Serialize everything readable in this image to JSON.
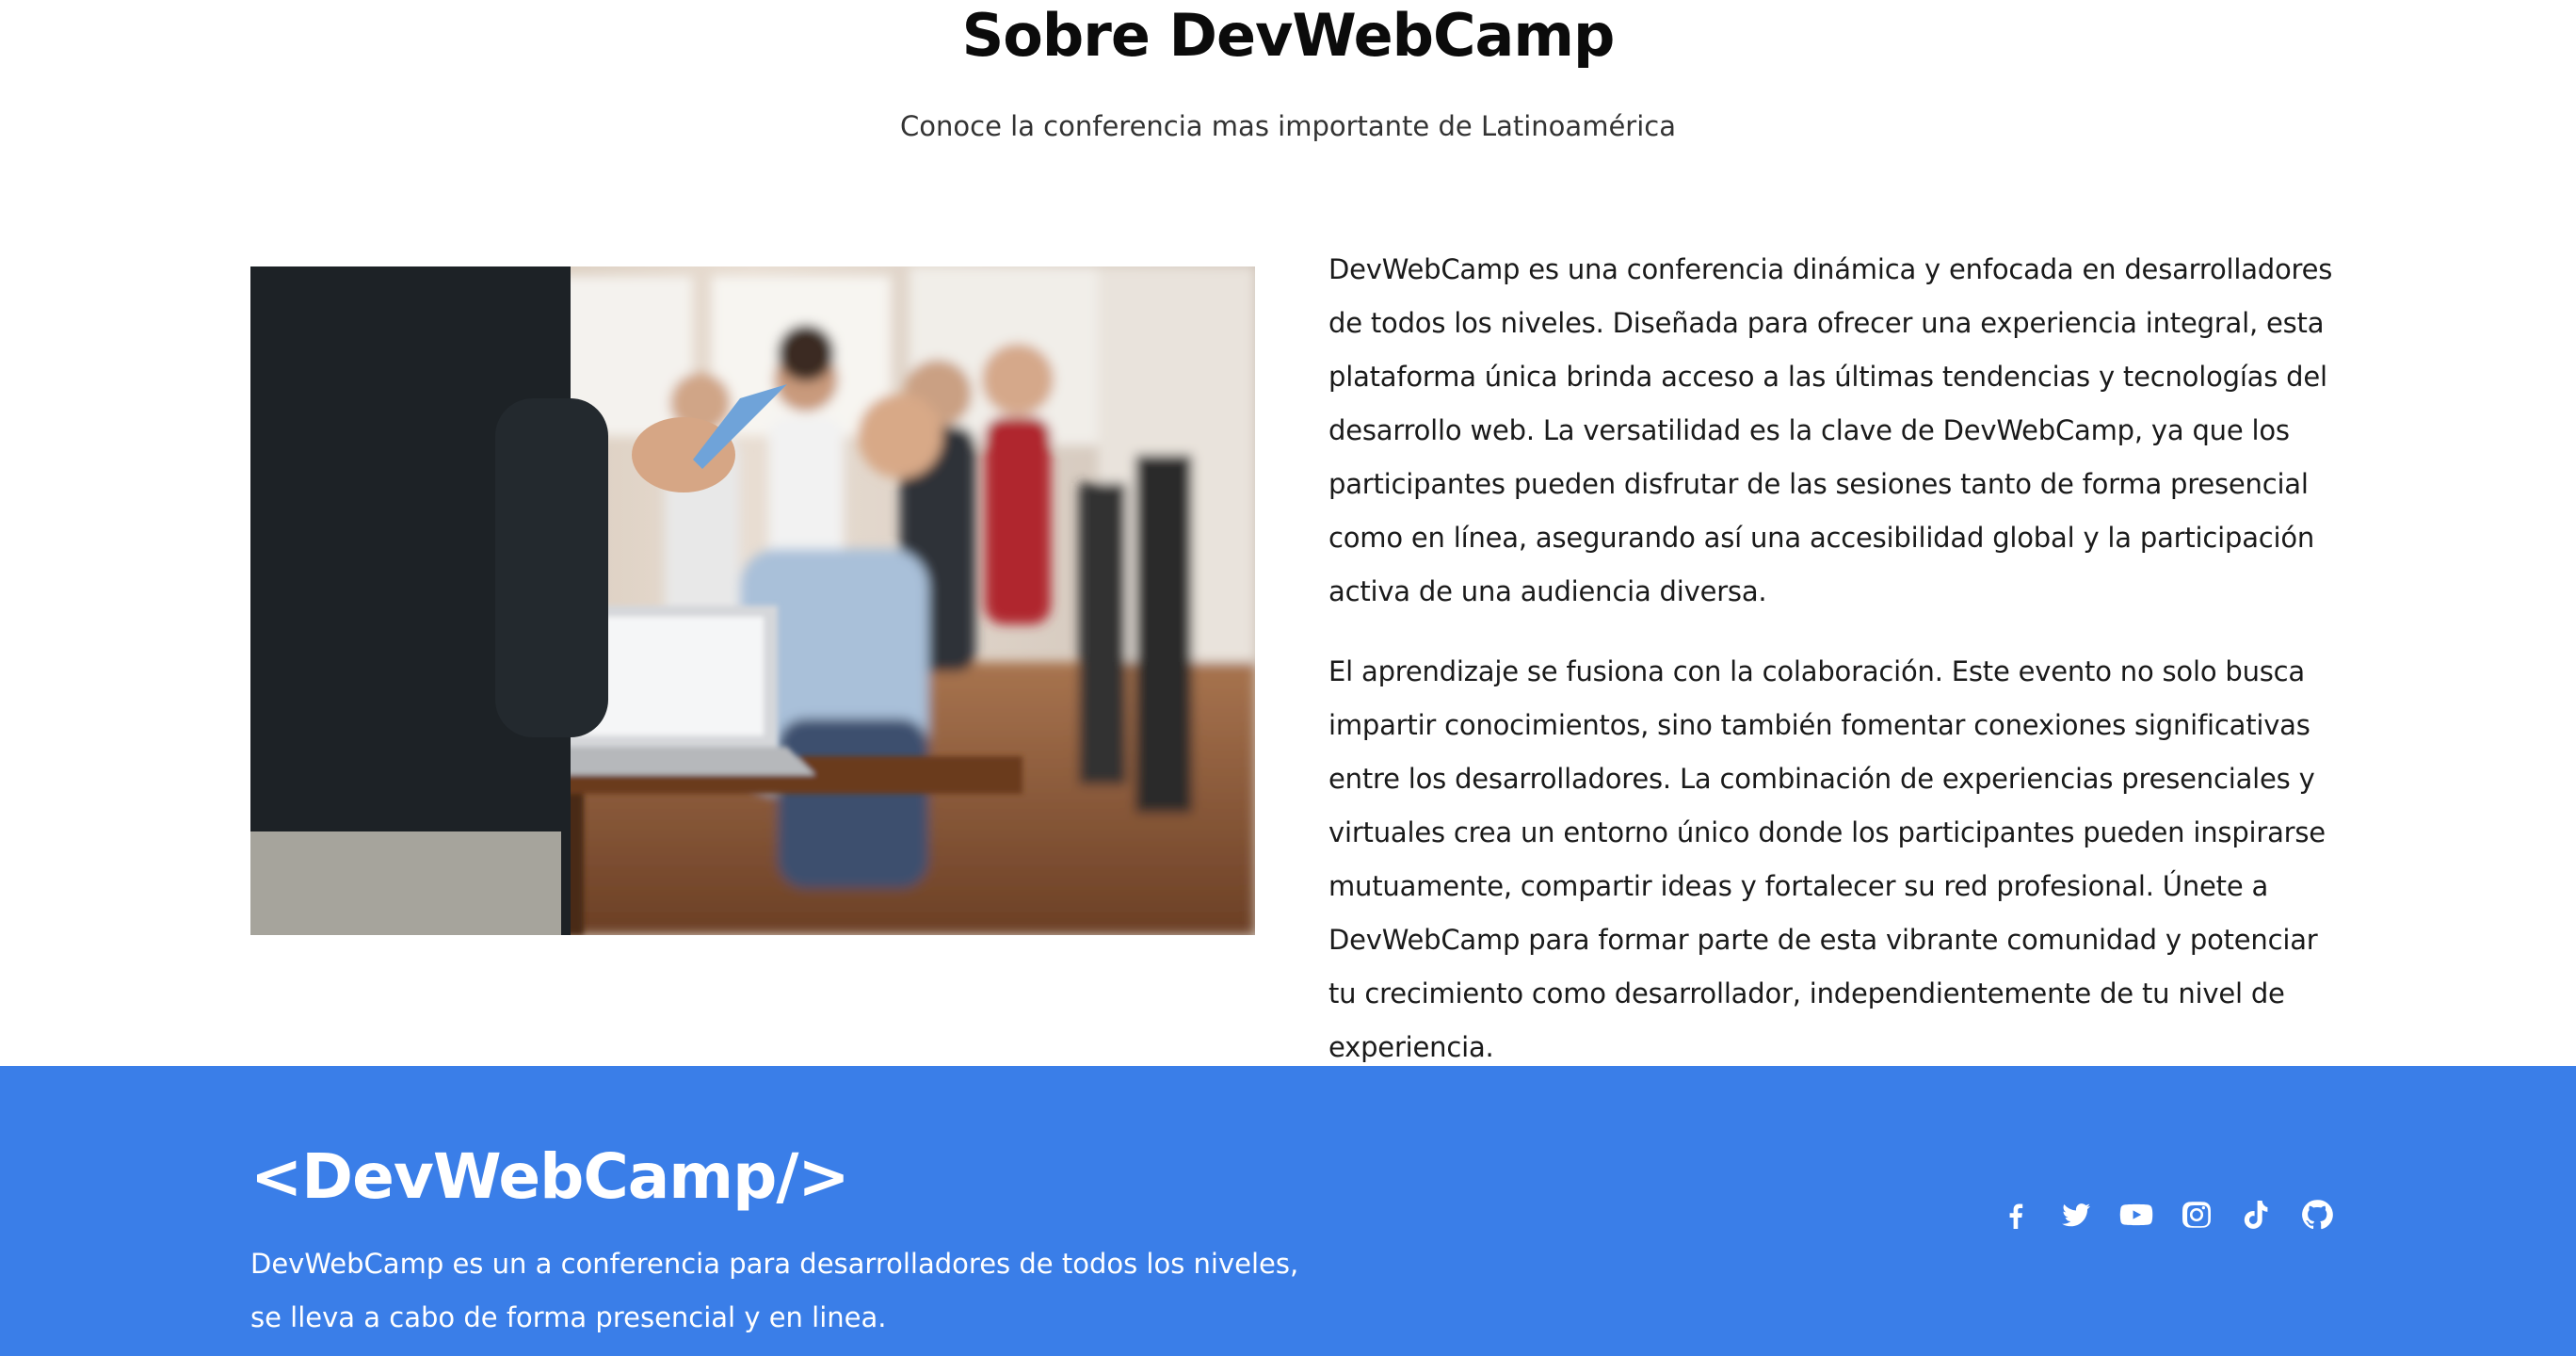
{
  "about": {
    "title": "Sobre DevWebCamp",
    "subtitle": "Conoce la conferencia mas importante de Latinoamérica",
    "paragraphs": [
      "DevWebCamp es una conferencia dinámica y enfocada en desarrolladores de todos los niveles. Diseñada para ofrecer una experiencia integral, esta plataforma única brinda acceso a las últimas tendencias y tecnologías del desarrollo web. La versatilidad es la clave de DevWebCamp, ya que los participantes pueden disfrutar de las sesiones tanto de forma presencial como en línea, asegurando así una accesibilidad global y la participación activa de una audiencia diversa.",
      "El aprendizaje se fusiona con la colaboración. Este evento no solo busca impartir conocimientos, sino también fomentar conexiones significativas entre los desarrolladores. La combinación de experiencias presenciales y virtuales crea un entorno único donde los participantes pueden inspirarse mutuamente, compartir ideas y fortalecer su red profesional. Únete a DevWebCamp para formar parte de esta vibrante comunidad y potenciar tu crecimiento como desarrollador, independientemente de tu nivel de experiencia."
    ]
  },
  "footer": {
    "logo": "<DevWebCamp/>",
    "description": "DevWebCamp es un a conferencia para desarrolladores de todos los niveles, se lleva a cabo de forma presencial y en linea.",
    "social": [
      "facebook-icon",
      "twitter-icon",
      "youtube-icon",
      "instagram-icon",
      "tiktok-icon",
      "github-icon"
    ]
  },
  "colors": {
    "footer_background": "#3a7ee8",
    "text": "#1a1a1a",
    "title": "#0b0b0b"
  }
}
